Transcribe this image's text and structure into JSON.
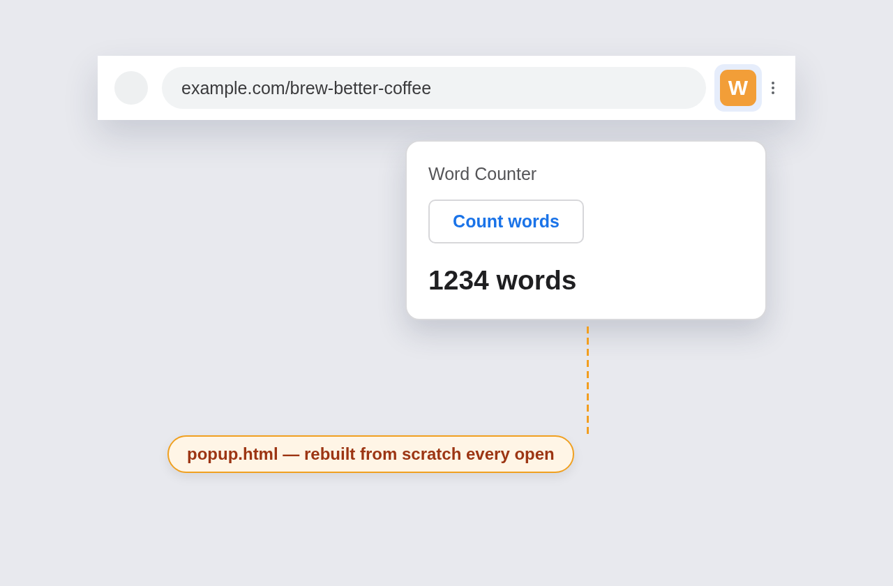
{
  "browser": {
    "url": "example.com/brew-better-coffee",
    "extension": {
      "letter": "W",
      "active": true
    }
  },
  "popup": {
    "title": "Word Counter",
    "button": "Count words",
    "result": "1234 words"
  },
  "callout": {
    "text": "popup.html — rebuilt from scratch every open"
  }
}
